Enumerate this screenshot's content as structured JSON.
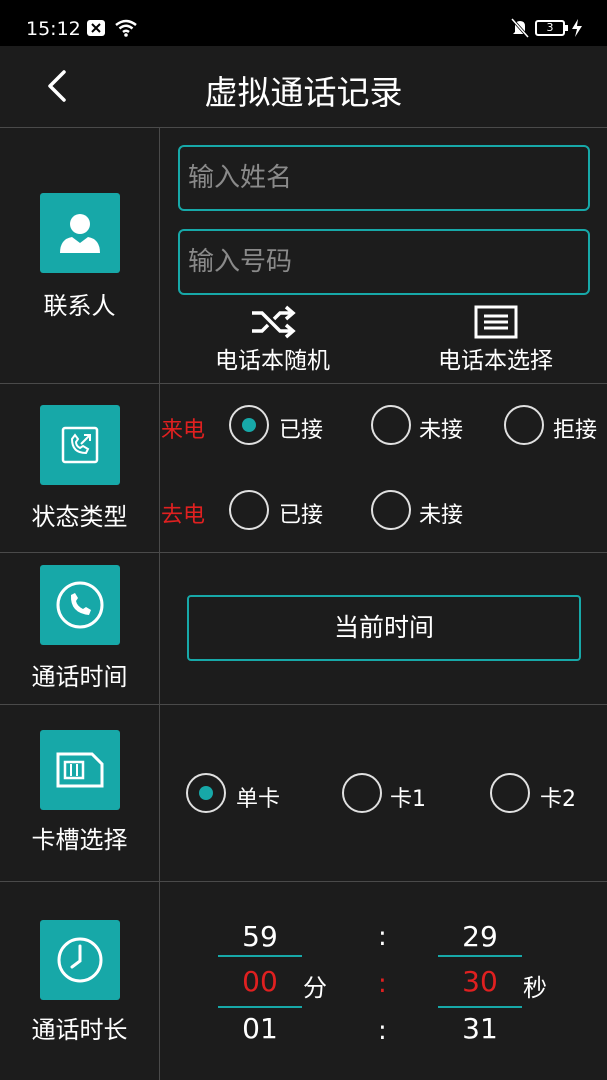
{
  "status_bar": {
    "time": "15:12",
    "battery": "3"
  },
  "header": {
    "title": "虚拟通话记录"
  },
  "contact": {
    "label": "联系人",
    "name_placeholder": "输入姓名",
    "number_placeholder": "输入号码",
    "random_label": "电话本随机",
    "select_label": "电话本选择"
  },
  "status_type": {
    "label": "状态类型",
    "incoming_label": "来电",
    "outgoing_label": "去电",
    "incoming_options": [
      "已接",
      "未接",
      "拒接"
    ],
    "outgoing_options": [
      "已接",
      "未接"
    ],
    "incoming_selected": "已接"
  },
  "call_time": {
    "label": "通话时间",
    "button_label": "当前时间"
  },
  "sim_slot": {
    "label": "卡槽选择",
    "options": [
      "单卡",
      "卡1",
      "卡2"
    ],
    "selected": "单卡"
  },
  "duration": {
    "label": "通话时长",
    "minutes": {
      "prev": "59",
      "current": "00",
      "next": "01",
      "unit": "分"
    },
    "seconds": {
      "prev": "29",
      "current": "30",
      "next": "31",
      "unit": "秒"
    },
    "separator": ":"
  },
  "colors": {
    "accent": "#17a8a8",
    "highlight": "#e02020",
    "background": "#1c1c1c"
  }
}
